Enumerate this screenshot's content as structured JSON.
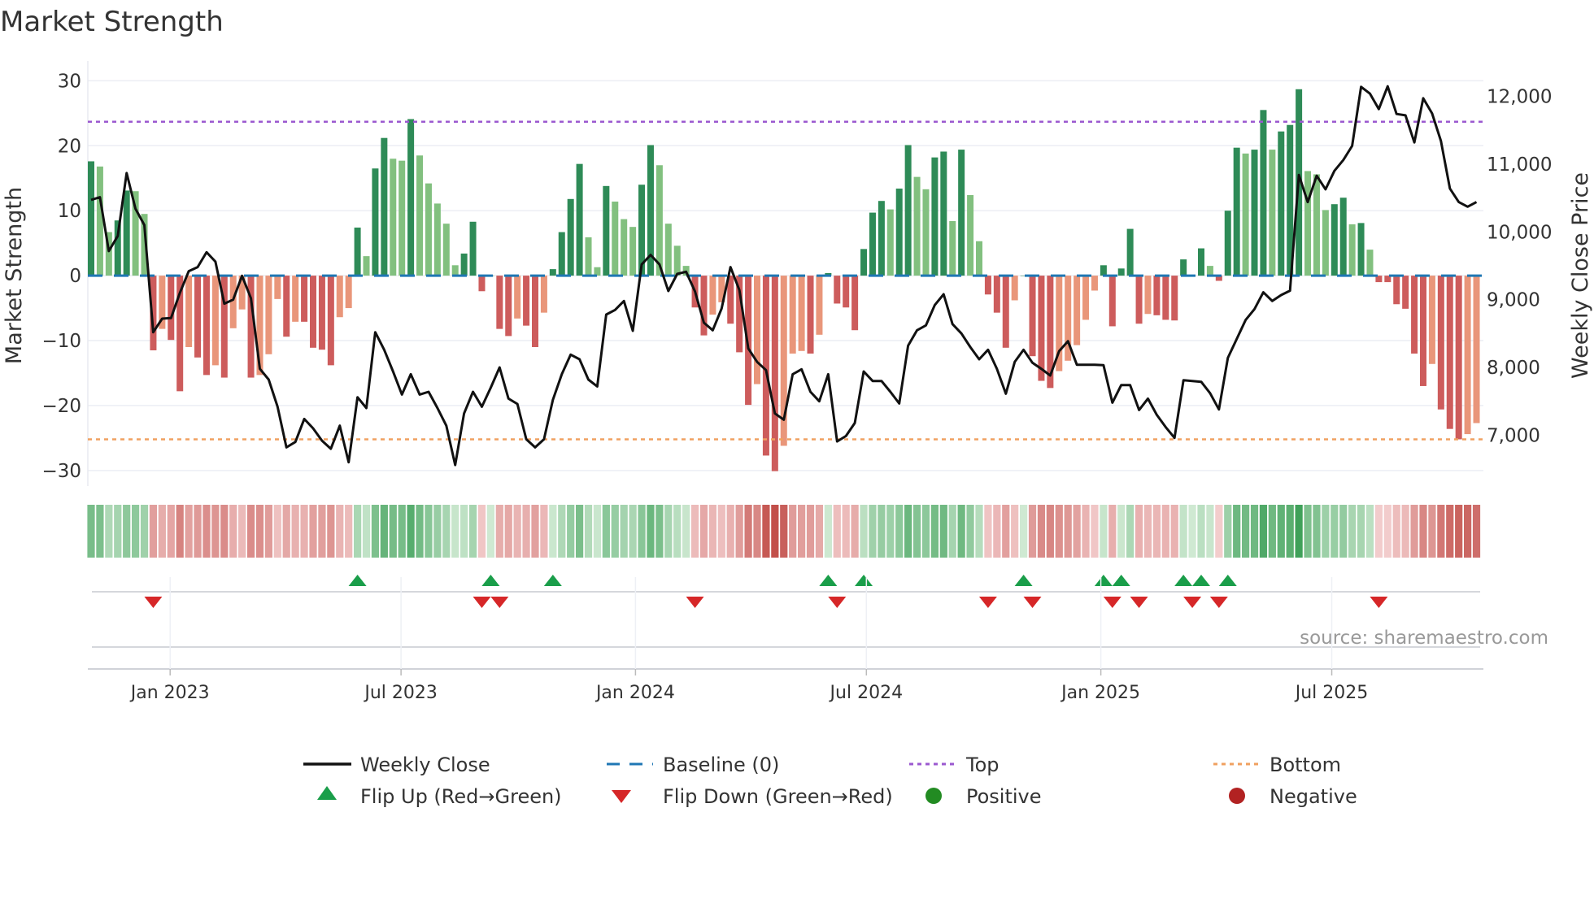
{
  "chart_data": {
    "type": "bar",
    "title": "Market Strength",
    "ylabel": "Market Strength",
    "ylabel_right": "Weekly Close Price",
    "ylim": [
      -32.4,
      32.3
    ],
    "ylim_right": [
      6249,
      12450
    ],
    "yticks": [
      30,
      20,
      10,
      0,
      -10,
      -20,
      -30
    ],
    "yticks_right": [
      12000,
      11000,
      10000,
      9000,
      8000,
      7000
    ],
    "ytick_labels": [
      "30",
      "20",
      "10",
      "0",
      "−10",
      "−20",
      "−30"
    ],
    "ytick_labels_right": [
      "12,000",
      "11,000",
      "10,000",
      "9,000",
      "8,000",
      "7,000"
    ],
    "xticks": [
      {
        "index": 8.9,
        "label": "Jan 2023"
      },
      {
        "index": 34.9,
        "label": "Jul 2023"
      },
      {
        "index": 61.3,
        "label": "Jan 2024"
      },
      {
        "index": 87.3,
        "label": "Jul 2024"
      },
      {
        "index": 113.7,
        "label": "Jan 2025"
      },
      {
        "index": 139.7,
        "label": "Jul 2025"
      }
    ],
    "top_level": 23.7,
    "bottom_level": -25.2,
    "baseline": 0,
    "strength": [
      17.6,
      16.8,
      6.7,
      8.5,
      13.1,
      13,
      9.5,
      -11.5,
      -8.2,
      -9.9,
      -17.8,
      -11,
      -12.6,
      -15.3,
      -13.8,
      -15.7,
      -8.1,
      -5.2,
      -15.7,
      -15.3,
      -12.1,
      -3.6,
      -9.4,
      -7.1,
      -7.1,
      -11.1,
      -11.4,
      -13.8,
      -6.4,
      -5,
      7.4,
      3,
      16.5,
      21.2,
      18,
      17.7,
      24.1,
      18.5,
      14.2,
      11.1,
      8,
      1.6,
      3.4,
      8.3,
      -2.4,
      0,
      -8.2,
      -9.3,
      -6.6,
      -7.7,
      -11,
      -5.7,
      1,
      6.7,
      11.8,
      17.2,
      5.9,
      1.3,
      13.8,
      11.4,
      8.7,
      7.5,
      14,
      20.1,
      17,
      8,
      4.6,
      1.5,
      -4.9,
      -9.2,
      -6,
      -4.1,
      -7.4,
      -11.8,
      -19.9,
      -16.7,
      -27.7,
      -30.1,
      -26.2,
      -12,
      -11.6,
      -12,
      -9.1,
      0.4,
      -4.3,
      -4.9,
      -8.4,
      4.1,
      9.7,
      11.5,
      10.2,
      13.4,
      20.1,
      15.2,
      13.3,
      18.2,
      19.1,
      8.4,
      19.4,
      12.4,
      5.3,
      -2.9,
      -5.7,
      -11.1,
      -3.8,
      0,
      -12.4,
      -16.2,
      -17.3,
      -14.7,
      -13.1,
      -10.7,
      -6.8,
      -2.3,
      1.6,
      -7.8,
      1.1,
      7.2,
      -7.4,
      -5.9,
      -6.1,
      -6.8,
      -6.9,
      2.5,
      0,
      4.2,
      1.5,
      -0.8,
      10,
      19.7,
      18.8,
      19.4,
      25.5,
      19.4,
      22.2,
      23.2,
      28.7,
      16.1,
      15.6,
      10.1,
      11,
      12,
      7.9,
      8.1,
      4,
      -1,
      -1,
      -4.4,
      -5.1,
      -12,
      -17,
      -13.6,
      -20.6,
      -23.6,
      -25.2,
      -24.4,
      -22.7
    ],
    "weekly_close": [
      10472,
      10512,
      9716,
      9940,
      10868,
      10340,
      10100,
      8520,
      8720,
      8728,
      9100,
      9420,
      9480,
      9700,
      9560,
      8940,
      9000,
      9352,
      9020,
      7980,
      7820,
      7420,
      6820,
      6900,
      7240,
      7100,
      6920,
      6800,
      7140,
      6600,
      7560,
      7400,
      8520,
      8260,
      7940,
      7600,
      7900,
      7600,
      7640,
      7400,
      7140,
      6560,
      7320,
      7640,
      7420,
      7700,
      8000,
      7540,
      7460,
      6940,
      6820,
      6940,
      7520,
      7900,
      8188,
      8120,
      7820,
      7720,
      8780,
      8848,
      8980,
      8540,
      9520,
      9660,
      9520,
      9128,
      9380,
      9412,
      9120,
      8660,
      8548,
      8868,
      9480,
      9140,
      8280,
      8080,
      7960,
      7320,
      7228,
      7900,
      7972,
      7640,
      7500,
      7900,
      6908,
      6988,
      7180,
      7940,
      7800,
      7800,
      7640,
      7468,
      8320,
      8548,
      8620,
      8920,
      9080,
      8640,
      8500,
      8300,
      8120,
      8260,
      7980,
      7612,
      8080,
      8260,
      8068,
      7980,
      7880,
      8240,
      8388,
      8040,
      8040,
      8040,
      8032,
      7480,
      7740,
      7740,
      7372,
      7540,
      7300,
      7120,
      6960,
      7812,
      7800,
      7788,
      7620,
      7380,
      8140,
      8420,
      8700,
      8860,
      9108,
      8980,
      9068,
      9132,
      10840,
      10440,
      10828,
      10628,
      10900,
      11060,
      11268,
      12140,
      12040,
      11812,
      12148,
      11740,
      11720,
      11320,
      11972,
      11748,
      11340,
      10640,
      10440,
      10372,
      10440
    ],
    "flip_up_indices": [
      30,
      45,
      52,
      83,
      87,
      105,
      114,
      116,
      123,
      125,
      128
    ],
    "flip_down_indices": [
      7,
      44,
      46,
      68,
      84,
      101,
      106,
      115,
      118,
      124,
      127,
      145
    ],
    "legend": {
      "placement": "bottom",
      "entries": [
        "Weekly Close",
        "Baseline (0)",
        "Top",
        "Bottom",
        "Flip Up (Red→Green)",
        "Flip Down (Green→Red)",
        "Positive",
        "Negative"
      ]
    },
    "source": "source: sharemaestro.com"
  },
  "colors": {
    "up_dark": "#2e8b57",
    "up_light": "#82c07f",
    "down_dark": "#cd5c5c",
    "down_light": "#e9967a",
    "close": "#111111",
    "baseline": "#1f77b4",
    "top": "#9b59d0",
    "bottom": "#f0a060",
    "flip_up": "#1a9e4a",
    "flip_down": "#d62728",
    "positive": "#228b22",
    "negative": "#b22222"
  }
}
